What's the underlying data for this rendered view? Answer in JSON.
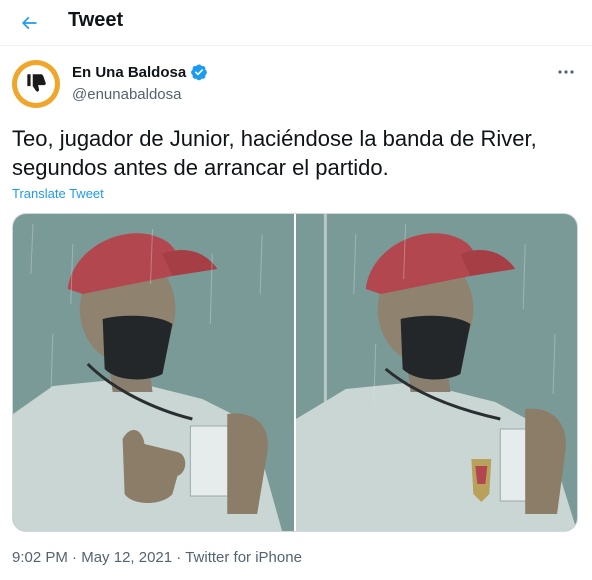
{
  "header": {
    "title": "Tweet",
    "back_icon": "arrow-left-icon"
  },
  "author": {
    "display_name": "En Una Baldosa",
    "handle": "@enunabaldosa",
    "verified": true,
    "avatar_colors": {
      "ring": "#f0a52b",
      "fill": "#ffffff",
      "glyph": "#1a1a1a"
    }
  },
  "tweet": {
    "text": "Teo, jugador de Junior, haciéndose la banda de River, segundos antes de arrancar el partido.",
    "translate_label": "Translate Tweet"
  },
  "media": {
    "photos": [
      {
        "alt": ""
      },
      {
        "alt": ""
      }
    ]
  },
  "meta": {
    "time": "9:02 PM",
    "separator": "·",
    "date": "May 12, 2021",
    "source": "Twitter for iPhone"
  },
  "colors": {
    "accent": "#1d9bf0",
    "text": "#0f1419",
    "secondary": "#536471"
  }
}
